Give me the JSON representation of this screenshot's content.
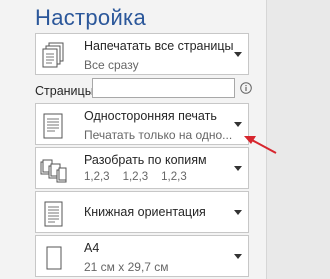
{
  "panel": {
    "title": "Настройка"
  },
  "settings": {
    "print_range": {
      "main": "Напечатать все страницы",
      "sub": "Все сразу",
      "icon": "pages-icon"
    },
    "pages": {
      "label": "Страницы:",
      "value": "",
      "placeholder": ""
    },
    "sides": {
      "main": "Односторонняя печать",
      "sub": "Печатать только на одно...",
      "icon": "single-sided-icon"
    },
    "collate": {
      "main": "Разобрать по копиям",
      "sub": [
        "1,2,3",
        "1,2,3",
        "1,2,3"
      ],
      "icon": "collate-icon"
    },
    "orientation": {
      "main": "Книжная ориентация",
      "icon": "portrait-orientation-icon"
    },
    "paper": {
      "main": "A4",
      "sub": "21 см x 29,7 см",
      "icon": "paper-size-icon"
    }
  },
  "colors": {
    "title": "#2b579a",
    "arrow": "#d7262e"
  }
}
